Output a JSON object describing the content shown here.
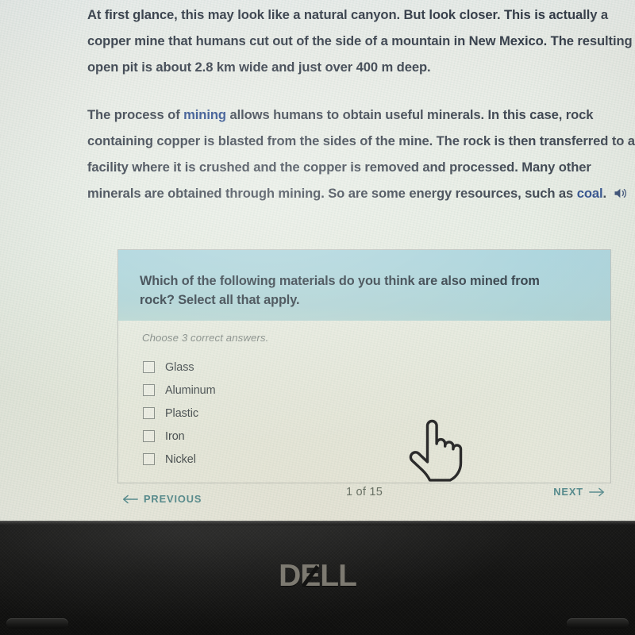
{
  "article": {
    "paragraph1_parts": [
      {
        "text": "At first glance, this may look like a natural canyon. But look closer. This is actually a copper mine that humans cut out of the side of a mountain in New Mexico. The resulting open pit is about 2.8 km wide and just over 400 m deep.",
        "style": "plain"
      }
    ],
    "paragraph1": "At first glance, this may look like a natural canyon. But look closer. This is actually a copper mine that humans cut out of the side of a mountain in New Mexico. The resulting open pit is about 2.8 km wide and just over 400 m deep.",
    "paragraph2_before_term": "The process of ",
    "paragraph2_term": "mining",
    "paragraph2_middle": " allows humans to obtain useful minerals. In this case, rock containing copper is blasted from the sides of the mine. The rock is then transferred to a facility where it is crushed and the copper is removed and processed. Many other minerals are obtained through mining. So are some energy resources, such as ",
    "paragraph2_term2": "coal",
    "paragraph2_after": ".",
    "speaker_icon": "speaker-icon",
    "link_color": "#1c3f82",
    "text_color": "#2b3440"
  },
  "exercise": {
    "question": "Which of the following materials do you think are also mined from rock? Select all that apply.",
    "hint": "Choose 3 correct answers.",
    "header_color": "#a8d3da",
    "options": [
      {
        "label": "Glass",
        "checked": false
      },
      {
        "label": "Aluminum",
        "checked": false
      },
      {
        "label": "Plastic",
        "checked": false
      },
      {
        "label": "Iron",
        "checked": false
      },
      {
        "label": "Nickel",
        "checked": false
      }
    ]
  },
  "navigation": {
    "previous_label": "PREVIOUS",
    "previous_icon": "arrow-left-icon",
    "next_label": "NEXT",
    "next_icon": "arrow-right-icon",
    "pager": "1 of 15",
    "accent_color": "#3f7f86"
  },
  "cursor": {
    "icon": "pointing-hand-cursor"
  },
  "hardware": {
    "brand_d": "D",
    "brand_e": "E",
    "brand_ll": "LL",
    "brand_full": "DELL",
    "logo_color": "#7d7a71"
  }
}
